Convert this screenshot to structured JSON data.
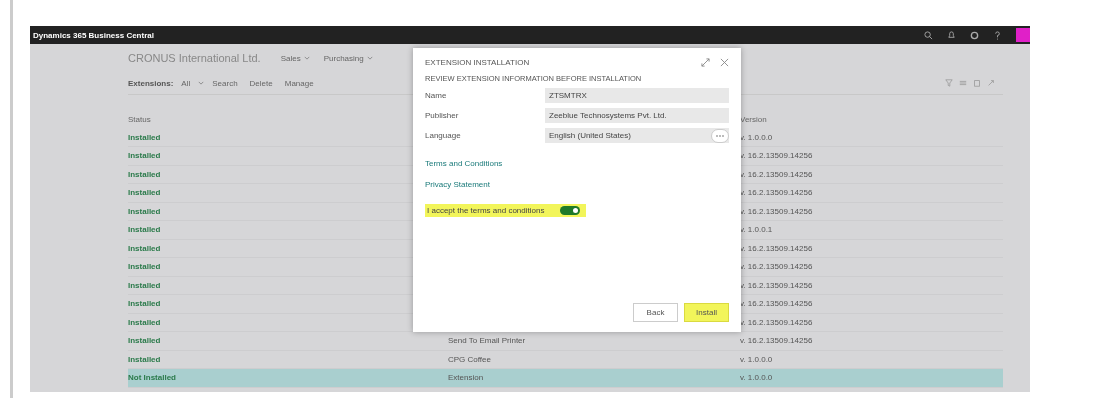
{
  "app_bar": {
    "title": "Dynamics 365 Business Central"
  },
  "header": {
    "company": "CRONUS International Ltd.",
    "nav": [
      "Sales",
      "Purchasing"
    ]
  },
  "toolbar": {
    "page": "Extensions:",
    "filter": "All",
    "actions": [
      "Search",
      "Delete",
      "Manage"
    ]
  },
  "table": {
    "columns": [
      "Status",
      "Version"
    ],
    "rows": [
      {
        "status": "Installed",
        "name": "",
        "version": "v. 1.0.0.0",
        "selected": false
      },
      {
        "status": "Installed",
        "name": "",
        "version": "v. 16.2.13509.14256",
        "selected": false
      },
      {
        "status": "Installed",
        "name": "",
        "version": "v. 16.2.13509.14256",
        "selected": false
      },
      {
        "status": "Installed",
        "name": "",
        "version": "v. 16.2.13509.14256",
        "selected": false
      },
      {
        "status": "Installed",
        "name": "",
        "version": "v. 16.2.13509.14256",
        "selected": false
      },
      {
        "status": "Installed",
        "name": "",
        "version": "v. 1.0.0.1",
        "selected": false
      },
      {
        "status": "Installed",
        "name": "",
        "version": "v. 16.2.13509.14256",
        "selected": false
      },
      {
        "status": "Installed",
        "name": "",
        "version": "v. 16.2.13509.14256",
        "selected": false
      },
      {
        "status": "Installed",
        "name": "",
        "version": "v. 16.2.13509.14256",
        "selected": false
      },
      {
        "status": "Installed",
        "name": "",
        "version": "v. 16.2.13509.14256",
        "selected": false
      },
      {
        "status": "Installed",
        "name": "",
        "version": "v. 16.2.13509.14256",
        "selected": false
      },
      {
        "status": "Installed",
        "name": "Send To Email Printer",
        "version": "v. 16.2.13509.14256",
        "selected": false
      },
      {
        "status": "Installed",
        "name": "CPG Coffee",
        "version": "v. 1.0.0.0",
        "selected": false
      },
      {
        "status": "Not Installed",
        "name": "Extension",
        "version": "v. 1.0.0.0",
        "selected": true
      }
    ]
  },
  "dialog": {
    "title": "EXTENSION INSTALLATION",
    "subtitle": "REVIEW EXTENSION INFORMATION BEFORE INSTALLATION",
    "fields": [
      {
        "label": "Name",
        "value": "ZTSMTRX",
        "kind": "text"
      },
      {
        "label": "Publisher",
        "value": "Zeeblue Technosystems Pvt. Ltd.",
        "kind": "text"
      },
      {
        "label": "Language",
        "value": "English (United States)",
        "kind": "lookup"
      }
    ],
    "links": [
      "Terms and Conditions",
      "Privacy Statement"
    ],
    "accept": {
      "label": "I accept the terms and conditions",
      "on": true,
      "highlighted": true
    },
    "buttons": [
      {
        "label": "Back",
        "highlighted": false
      },
      {
        "label": "Install",
        "highlighted": true
      }
    ]
  }
}
